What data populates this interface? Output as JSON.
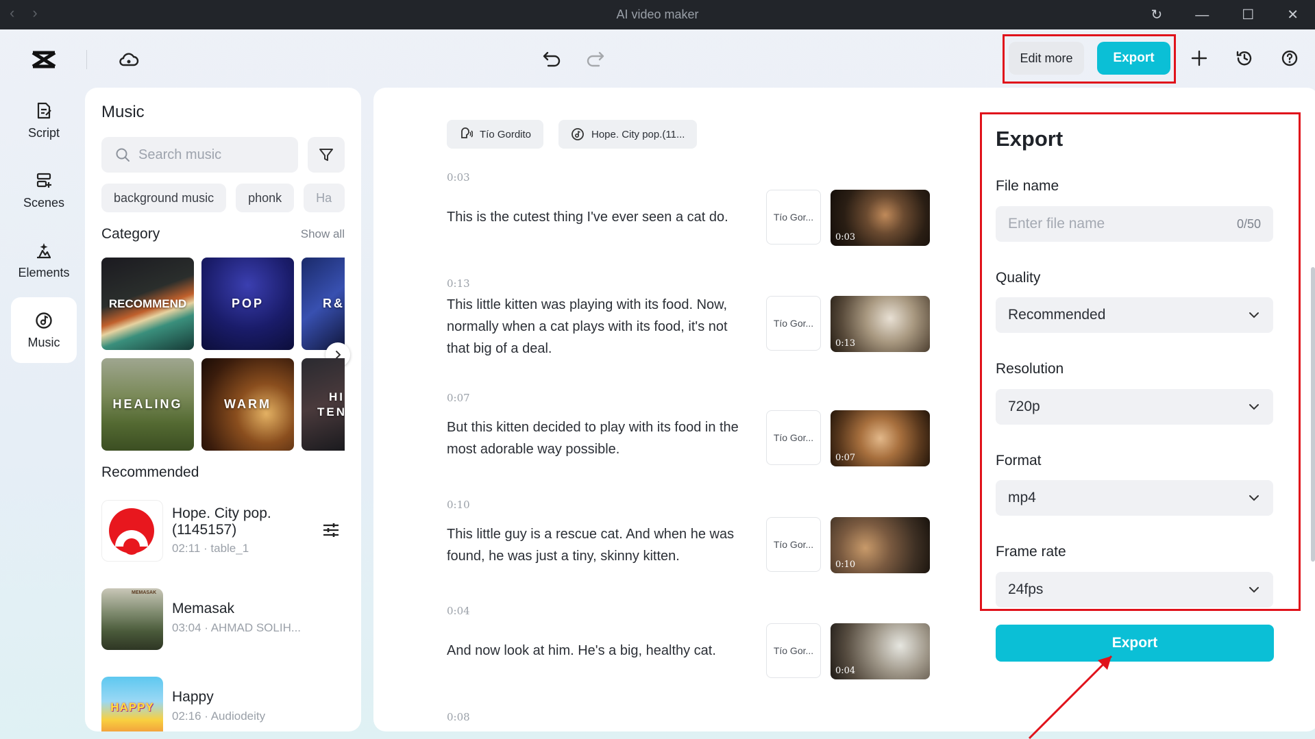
{
  "window": {
    "title": "AI video maker"
  },
  "toolbar": {
    "edit_more": "Edit more",
    "export": "Export"
  },
  "leftnav": [
    {
      "label": "Script"
    },
    {
      "label": "Scenes"
    },
    {
      "label": "Elements"
    },
    {
      "label": "Music"
    }
  ],
  "music": {
    "title": "Music",
    "search_placeholder": "Search music",
    "chips": [
      "background music",
      "phonk",
      "Ha"
    ],
    "category_title": "Category",
    "show_all": "Show all",
    "tiles": [
      "RECOMMEND",
      "POP",
      "R&",
      "HEALING",
      "WARM",
      "HI TEN"
    ],
    "recommended_title": "Recommended",
    "songs": [
      {
        "name": "Hope. City pop. (1145157)",
        "meta": "02:11 · table_1"
      },
      {
        "name": "Memasak",
        "meta": "03:04 · AHMAD SOLIH...",
        "thumb_text": "MEMASAK"
      },
      {
        "name": "Happy",
        "meta": "02:16 · Audiodeity",
        "thumb_text": "HAPPY"
      }
    ]
  },
  "script": {
    "voice_chip": "Tío Gordito",
    "music_chip": "Hope. City pop.(11...",
    "segments": [
      {
        "time": "0:03",
        "text": "This is the cutest thing I've ever seen a cat do.",
        "voice": "Tío Gor...",
        "duration": "0:03"
      },
      {
        "time": "0:13",
        "text": "This little kitten was playing with its food. Now, normally when a cat plays with its food, it's not that big of a deal.",
        "voice": "Tío Gor...",
        "duration": "0:13"
      },
      {
        "time": "0:07",
        "text": "But this kitten decided to play with its food in the most adorable way possible.",
        "voice": "Tío Gor...",
        "duration": "0:07"
      },
      {
        "time": "0:10",
        "text": "This little guy is a rescue cat. And when he was found, he was just a tiny, skinny kitten.",
        "voice": "Tío Gor...",
        "duration": "0:10"
      },
      {
        "time": "0:04",
        "text": "And now look at him. He's a big, healthy cat.",
        "voice": "Tío Gor...",
        "duration": "0:04"
      },
      {
        "time": "0:08"
      }
    ]
  },
  "export": {
    "title": "Export",
    "file_name_label": "File name",
    "file_name_placeholder": "Enter file name",
    "file_name_count": "0/50",
    "quality_label": "Quality",
    "quality_value": "Recommended",
    "resolution_label": "Resolution",
    "resolution_value": "720p",
    "format_label": "Format",
    "format_value": "mp4",
    "frame_rate_label": "Frame rate",
    "frame_rate_value": "24fps",
    "button": "Export"
  },
  "colors": {
    "accent": "#0bbfd6",
    "highlight": "#e0121b"
  }
}
